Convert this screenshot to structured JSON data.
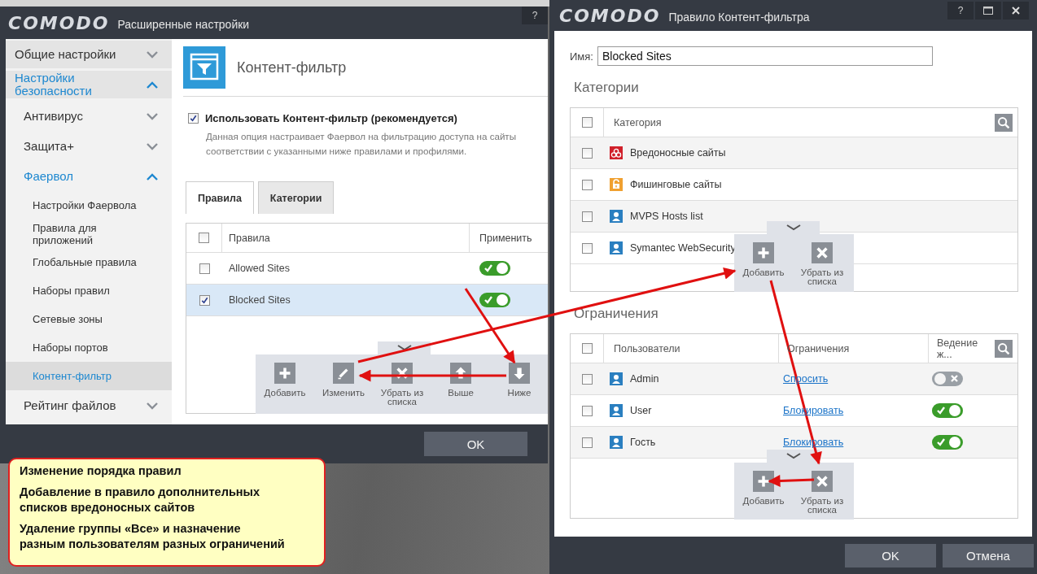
{
  "left_window": {
    "brand": "COMODO",
    "title": "Расширенные настройки",
    "help": "?",
    "sidebar": {
      "items": [
        {
          "label": "Общие настройки",
          "expanded": false
        },
        {
          "label": "Настройки безопасности",
          "expanded": true,
          "children": [
            {
              "label": "Антивирус",
              "expanded": false
            },
            {
              "label": "Защита+",
              "expanded": false
            },
            {
              "label": "Фаервол",
              "expanded": true,
              "children": [
                {
                  "label": "Настройки Фаервола",
                  "selected": false
                },
                {
                  "label": "Правила для приложений",
                  "selected": false
                },
                {
                  "label": "Глобальные правила",
                  "selected": false
                },
                {
                  "label": "Наборы правил",
                  "selected": false
                },
                {
                  "label": "Сетевые зоны",
                  "selected": false
                },
                {
                  "label": "Наборы портов",
                  "selected": false
                },
                {
                  "label": "Контент-фильтр",
                  "selected": true
                }
              ]
            },
            {
              "label": "Рейтинг файлов",
              "expanded": false
            }
          ]
        }
      ]
    },
    "page": {
      "title": "Контент-фильтр",
      "enable": {
        "label": "Использовать Контент-фильтр (рекомендуется)",
        "checked": true
      },
      "description_lines": [
        "Данная опция настраивает Фаервол на фильтрацию доступа на сайты",
        "соответствии с указанными ниже правилами и профилями."
      ],
      "tabs": [
        {
          "label": "Правила",
          "selected": true
        },
        {
          "label": "Категории",
          "selected": false
        }
      ],
      "table": {
        "columns": [
          "Правила",
          "Применить"
        ],
        "header_checked": false,
        "rows": [
          {
            "name": "Allowed Sites",
            "checked": false,
            "selected": false,
            "on": true
          },
          {
            "name": "Blocked Sites",
            "checked": true,
            "selected": true,
            "on": true
          }
        ]
      },
      "toolbar": [
        {
          "kind": "add",
          "label": "Добавить"
        },
        {
          "kind": "edit",
          "label": "Изменить"
        },
        {
          "kind": "remove",
          "label": "Убрать из списка"
        },
        {
          "kind": "up",
          "label": "Выше"
        },
        {
          "kind": "down",
          "label": "Ниже"
        }
      ]
    },
    "buttons": [
      "OK"
    ]
  },
  "right_window": {
    "brand": "COMODO",
    "title": "Правило Контент-фильтра",
    "help": "?",
    "name_label": "Имя:",
    "name_value": "Blocked Sites",
    "categories": {
      "heading": "Категории",
      "column": "Категория",
      "header_checked": false,
      "rows": [
        {
          "kind": "malware",
          "name": "Вредоносные сайты",
          "checked": false
        },
        {
          "kind": "phishing",
          "name": "Фишинговые сайты",
          "checked": false
        },
        {
          "kind": "user",
          "name": "MVPS Hosts list",
          "checked": false
        },
        {
          "kind": "user",
          "name": "Symantec WebSecurity",
          "checked": false
        }
      ],
      "toolbar": [
        {
          "kind": "add",
          "label": "Добавить"
        },
        {
          "kind": "remove",
          "label": "Убрать из списка"
        }
      ]
    },
    "restrictions": {
      "heading": "Ограничения",
      "columns": [
        "Пользователи",
        "Ограничения",
        "Ведение ж..."
      ],
      "header_checked": false,
      "rows": [
        {
          "user": "Admin",
          "restriction": "Спросить",
          "checked": false,
          "on": false
        },
        {
          "user": "User",
          "restriction": "Блокировать",
          "checked": false,
          "on": true
        },
        {
          "user": "Гость",
          "restriction": "Блокировать",
          "checked": false,
          "on": true
        }
      ],
      "toolbar": [
        {
          "kind": "add",
          "label": "Добавить"
        },
        {
          "kind": "remove",
          "label": "Убрать из списка"
        }
      ]
    },
    "buttons": [
      "OK",
      "Отмена"
    ]
  },
  "note": {
    "paragraphs": [
      [
        "Изменение порядка правил"
      ],
      [
        "Добавление в правило дополнительных",
        "списков вредоносных сайтов"
      ],
      [
        "Удаление группы «Все» и назначение",
        "разным пользователям разных ограничений"
      ]
    ]
  }
}
